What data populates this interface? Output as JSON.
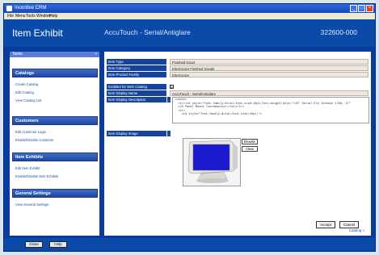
{
  "window": {
    "title": "Incentive CRM"
  },
  "menu": [
    "File",
    "Menu",
    "Tools",
    "Window",
    "Help"
  ],
  "header": {
    "title": "Item Exhibit",
    "subtitle": "AccuTouch - Serial/Antiglare",
    "code": "322600-000"
  },
  "sidebar": {
    "title": "Tasks",
    "toggle": "«",
    "groups": [
      {
        "label": "Catalogs",
        "links": [
          "Create Catalog",
          "Edit Catalog",
          "View Catalog List"
        ]
      },
      {
        "label": "Customers",
        "links": [
          "Edit Customer Login",
          "Enable/Disable Customer"
        ]
      },
      {
        "label": "Item Exhibits",
        "links": [
          "Edit Item Exhibit",
          "Enable/Disable Item Exhibits"
        ]
      },
      {
        "label": "General Settings",
        "links": [
          "View General Settings"
        ]
      }
    ]
  },
  "form": {
    "item_type_label": "Item Type",
    "item_type_value": "Finished Good",
    "item_category_label": "Item Category",
    "item_category_value": "Electronics Finished Goods",
    "item_product_family_label": "Item Product Family",
    "item_product_family_value": "Electronics",
    "enabled_label": "Enabled for Web Catalog",
    "enabled_check": "☑",
    "display_name_label": "Item Display Name",
    "display_name_value": "AccuTouch - Serial/Antiglare",
    "display_desc_label": "Item Display Description",
    "display_desc_value": "<table>\n  <tr><td style=\"font-family:Arial;font-size:10pt;font-weight:bold;\">15\" Serial Elo Intouch 1766, 17\"\n  LCD Panel Mount Touchmonitor</td></tr>\n  <tr>\n    <td style=\"font-family:Arial;font-size:10pt;\">",
    "display_image_label": "Item Display Image",
    "picker_btn": "...",
    "browse_label": "Browse",
    "clear_label": "Clear"
  },
  "actions": {
    "accept": "Accept",
    "cancel": "Cancel"
  },
  "catalog_link": "Catalog »",
  "footer": {
    "close": "Close",
    "help": "Help"
  }
}
